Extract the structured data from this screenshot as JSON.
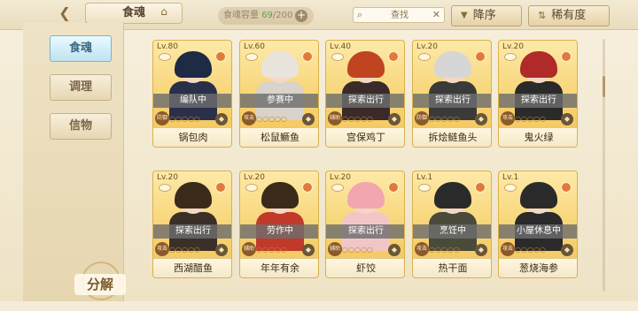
{
  "header": {
    "title": "食魂",
    "capacity_label": "食魂容量",
    "capacity_current": "69",
    "capacity_total": "/200",
    "search_placeholder": "查找",
    "sort_desc_label": "降序",
    "sort_rarity_label": "稀有度"
  },
  "sidebar": {
    "tabs": [
      {
        "label": "食魂",
        "active": true
      },
      {
        "label": "调理",
        "active": false
      },
      {
        "label": "信物",
        "active": false
      }
    ],
    "decompose_label": "分解"
  },
  "colors": {
    "accent_active_tab": "#bfe3f0",
    "card_gold": "#f7d26f",
    "status_overlay": "#6e6e6e",
    "capacity_current": "#5da34a"
  },
  "cards": [
    {
      "level": "Lv.80",
      "status": "编队中",
      "name": "锅包肉",
      "role": "防御",
      "hair": "#1f2a44",
      "outfit": "#2a2f4a"
    },
    {
      "level": "Lv.60",
      "status": "参赛中",
      "name": "松鼠鳜鱼",
      "role": "攻击",
      "hair": "#e9e4dc",
      "outfit": "#d9d3cb"
    },
    {
      "level": "Lv.40",
      "status": "探索出行",
      "name": "宫保鸡丁",
      "role": "辅助",
      "hair": "#c0441f",
      "outfit": "#3a2a2a"
    },
    {
      "level": "Lv.20",
      "status": "探索出行",
      "name": "拆烩鲢鱼头",
      "role": "防御",
      "hair": "#d6d6d6",
      "outfit": "#3a3a3a"
    },
    {
      "level": "Lv.20",
      "status": "探索出行",
      "name": "鬼火绿",
      "role": "攻击",
      "hair": "#b02a2a",
      "outfit": "#2a2a2a"
    },
    {
      "level": "Lv.20",
      "status": "探索出行",
      "name": "西湖醋鱼",
      "role": "攻击",
      "hair": "#3a2a1a",
      "outfit": "#3a3028"
    },
    {
      "level": "Lv.20",
      "status": "劳作中",
      "name": "年年有余",
      "role": "辅助",
      "hair": "#3a2a1a",
      "outfit": "#c0392b"
    },
    {
      "level": "Lv.20",
      "status": "探索出行",
      "name": "虾饺",
      "role": "辅助",
      "hair": "#f2a6b0",
      "outfit": "#f2c6c6"
    },
    {
      "level": "Lv.1",
      "status": "烹饪中",
      "name": "热干面",
      "role": "攻击",
      "hair": "#2a2a2a",
      "outfit": "#4a4a3a"
    },
    {
      "level": "Lv.1",
      "status": "小屋休息中",
      "name": "葱烧海参",
      "role": "攻击",
      "hair": "#2a2a2a",
      "outfit": "#2a2a2a"
    }
  ]
}
